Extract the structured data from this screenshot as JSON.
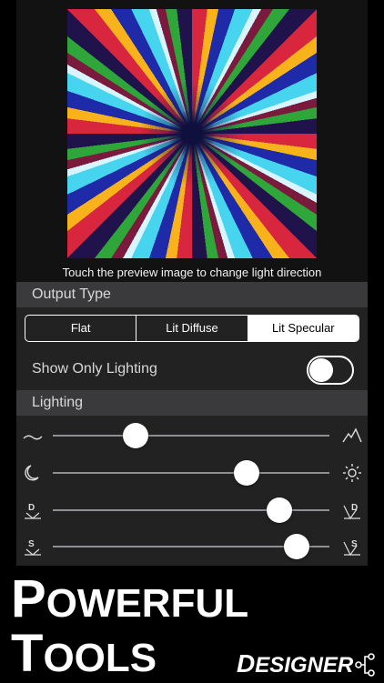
{
  "preview": {
    "hint": "Touch the preview image to change light direction"
  },
  "output_type": {
    "header": "Output Type",
    "options": [
      {
        "label": "Flat",
        "selected": false
      },
      {
        "label": "Lit Diffuse",
        "selected": false
      },
      {
        "label": "Lit Specular",
        "selected": true
      }
    ]
  },
  "show_only_lighting": {
    "label": "Show Only Lighting",
    "on": false
  },
  "lighting": {
    "header": "Lighting",
    "sliders": [
      {
        "name": "height",
        "left_icon": "flat-wave-icon",
        "right_icon": "mountains-icon",
        "value": 0.3
      },
      {
        "name": "brightness",
        "left_icon": "moon-icon",
        "right_icon": "sun-icon",
        "value": 0.7
      },
      {
        "name": "diffuse",
        "left_icon": "diffuse-low-icon",
        "right_icon": "diffuse-high-icon",
        "value": 0.82,
        "left_letter": "D",
        "right_letter": "D"
      },
      {
        "name": "specular",
        "left_icon": "specular-low-icon",
        "right_icon": "specular-high-icon",
        "value": 0.88,
        "left_letter": "S",
        "right_letter": "S"
      }
    ]
  },
  "promo": {
    "line1_initial": "P",
    "line1_rest": "OWERFUL",
    "line2_initial": "T",
    "line2_rest": "OOLS",
    "brand_initial": "D",
    "brand_rest": "ESIGNER"
  },
  "colors": {
    "panel": "#222223",
    "header": "#3a3a3c",
    "accent": "#ffffff"
  }
}
